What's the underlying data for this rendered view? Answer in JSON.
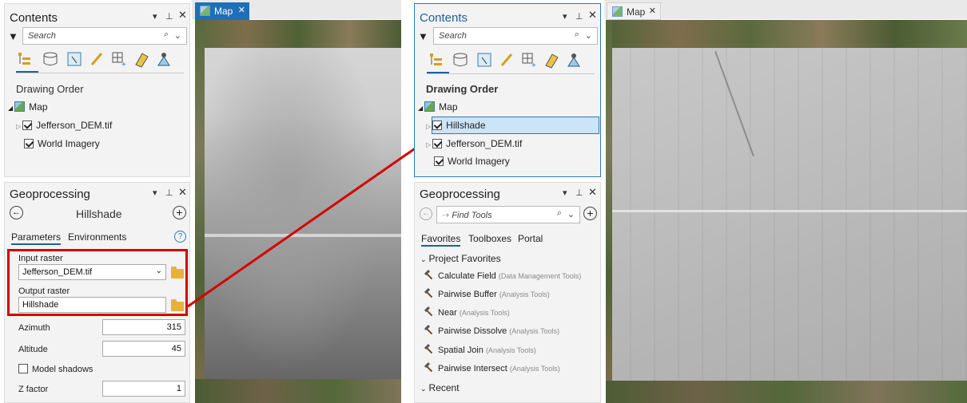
{
  "left": {
    "contents": {
      "title": "Contents",
      "search_placeholder": "Search",
      "section": "Drawing Order",
      "map_label": "Map",
      "layers": [
        {
          "label": "Jefferson_DEM.tif",
          "checked": true
        },
        {
          "label": "World Imagery",
          "checked": true
        }
      ]
    },
    "geoprocessing": {
      "title": "Geoprocessing",
      "tool_title": "Hillshade",
      "tabs": [
        "Parameters",
        "Environments"
      ],
      "input_raster_label": "Input raster",
      "input_raster_value": "Jefferson_DEM.tif",
      "output_raster_label": "Output raster",
      "output_raster_value": "Hillshade",
      "azimuth_label": "Azimuth",
      "azimuth_value": "315",
      "altitude_label": "Altitude",
      "altitude_value": "45",
      "model_shadows_label": "Model shadows",
      "zfactor_label": "Z factor",
      "zfactor_value": "1"
    },
    "map_tab": "Map"
  },
  "right": {
    "contents": {
      "title": "Contents",
      "search_placeholder": "Search",
      "section": "Drawing Order",
      "map_label": "Map",
      "layers": [
        {
          "label": "Hillshade",
          "checked": true,
          "selected": true
        },
        {
          "label": "Jefferson_DEM.tif",
          "checked": true
        },
        {
          "label": "World Imagery",
          "checked": true
        }
      ]
    },
    "geoprocessing": {
      "title": "Geoprocessing",
      "find_placeholder": "Find Tools",
      "tabs": [
        "Favorites",
        "Toolboxes",
        "Portal"
      ],
      "project_favorites": "Project Favorites",
      "tools": [
        {
          "name": "Calculate Field",
          "toolbox": "(Data Management Tools)"
        },
        {
          "name": "Pairwise Buffer",
          "toolbox": "(Analysis Tools)"
        },
        {
          "name": "Near",
          "toolbox": "(Analysis Tools)"
        },
        {
          "name": "Pairwise Dissolve",
          "toolbox": "(Analysis Tools)"
        },
        {
          "name": "Spatial Join",
          "toolbox": "(Analysis Tools)"
        },
        {
          "name": "Pairwise Intersect",
          "toolbox": "(Analysis Tools)"
        }
      ],
      "recent": "Recent"
    },
    "map_tab": "Map"
  },
  "colors": {
    "highlight_box": "#d40000",
    "selection": "#cce4f7",
    "accent": "#1f5fa0"
  }
}
